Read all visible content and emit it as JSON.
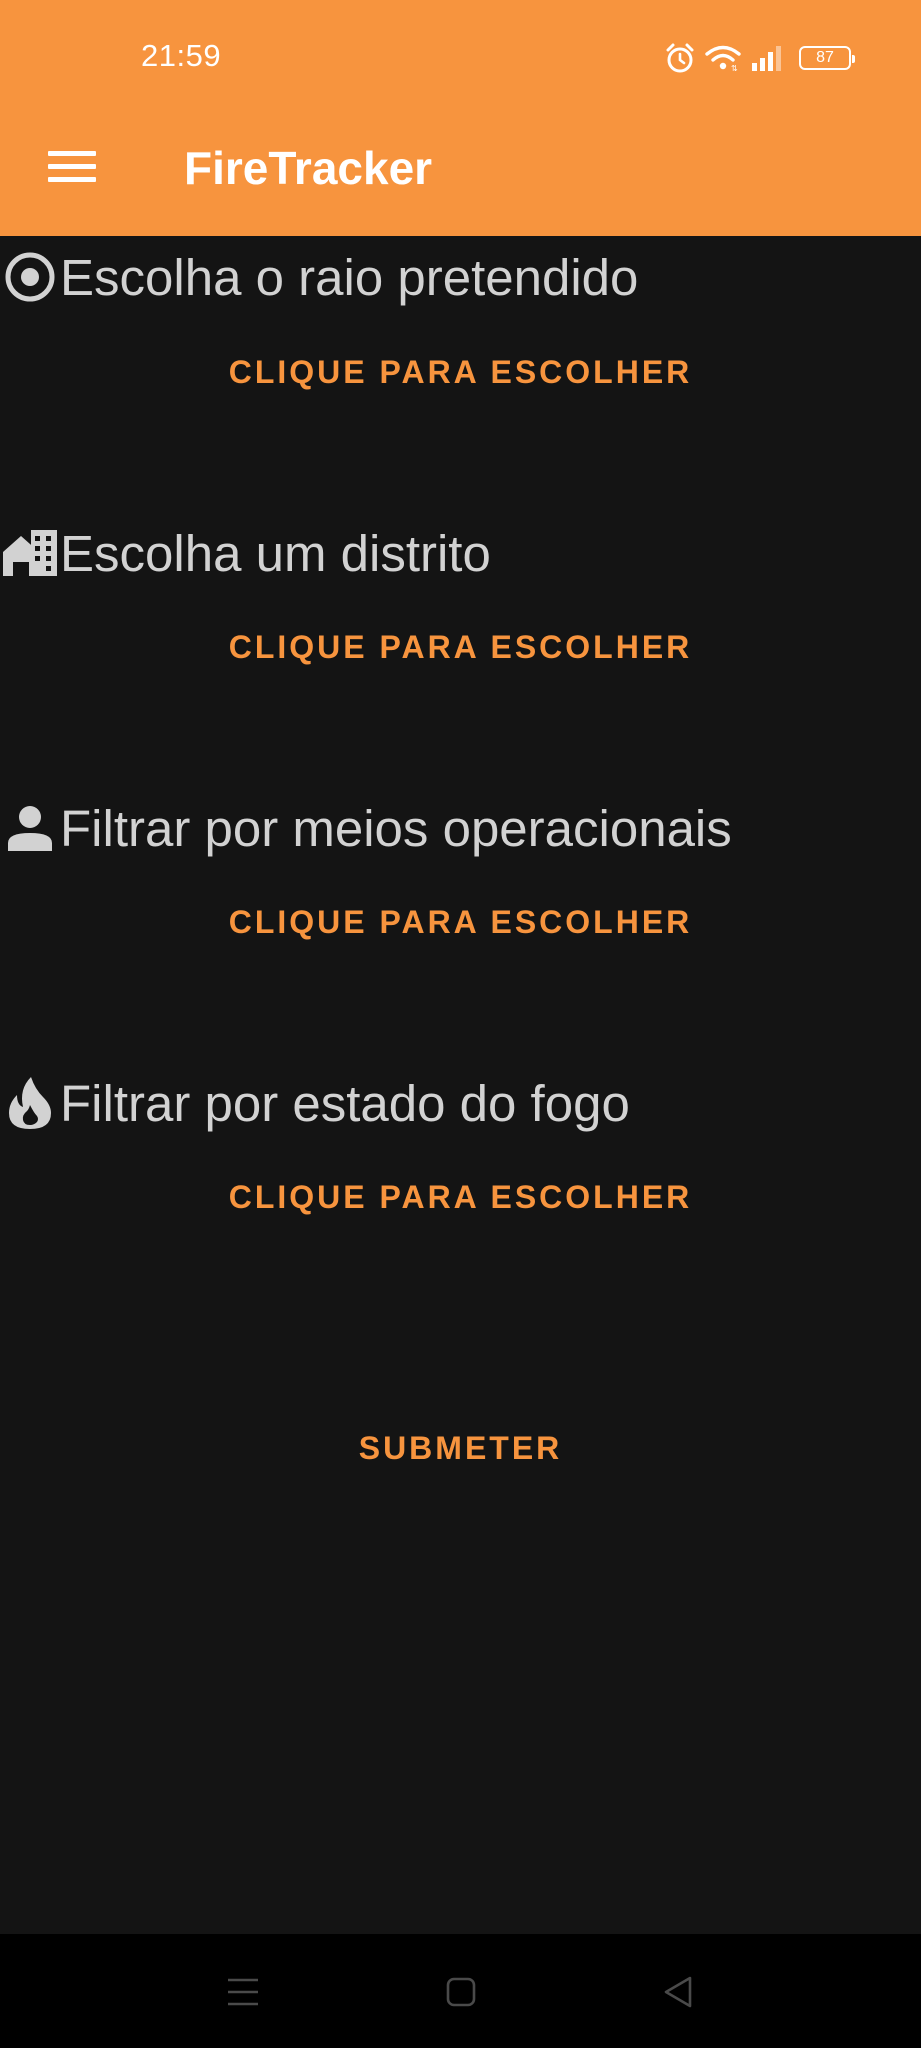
{
  "status_bar": {
    "time": "21:59",
    "battery": "87",
    "icons": [
      "alarm-icon",
      "wifi-icon",
      "signal-icon",
      "battery-icon"
    ]
  },
  "app_bar": {
    "title": "FireTracker",
    "menu_icon": "hamburger-menu-icon",
    "background_color": "#F7943E"
  },
  "filters": [
    {
      "icon": "radius-target-icon",
      "label": "Escolha o raio pretendido",
      "button_label": "CLIQUE PARA ESCOLHER"
    },
    {
      "icon": "district-building-icon",
      "label": "Escolha um distrito",
      "button_label": "CLIQUE PARA ESCOLHER"
    },
    {
      "icon": "person-icon",
      "label": "Filtrar por meios operacionais",
      "button_label": "CLIQUE PARA ESCOLHER"
    },
    {
      "icon": "fire-icon",
      "label": "Filtrar por estado do fogo",
      "button_label": "CLIQUE PARA ESCOLHER"
    }
  ],
  "submit": {
    "label": "SUBMETER"
  },
  "colors": {
    "accent": "#F7943E",
    "background": "#141414",
    "label_text": "#D2D2D2",
    "nav_bar": "#000000"
  },
  "nav_bar": {
    "buttons": [
      "recents-icon",
      "home-icon",
      "back-icon"
    ]
  }
}
